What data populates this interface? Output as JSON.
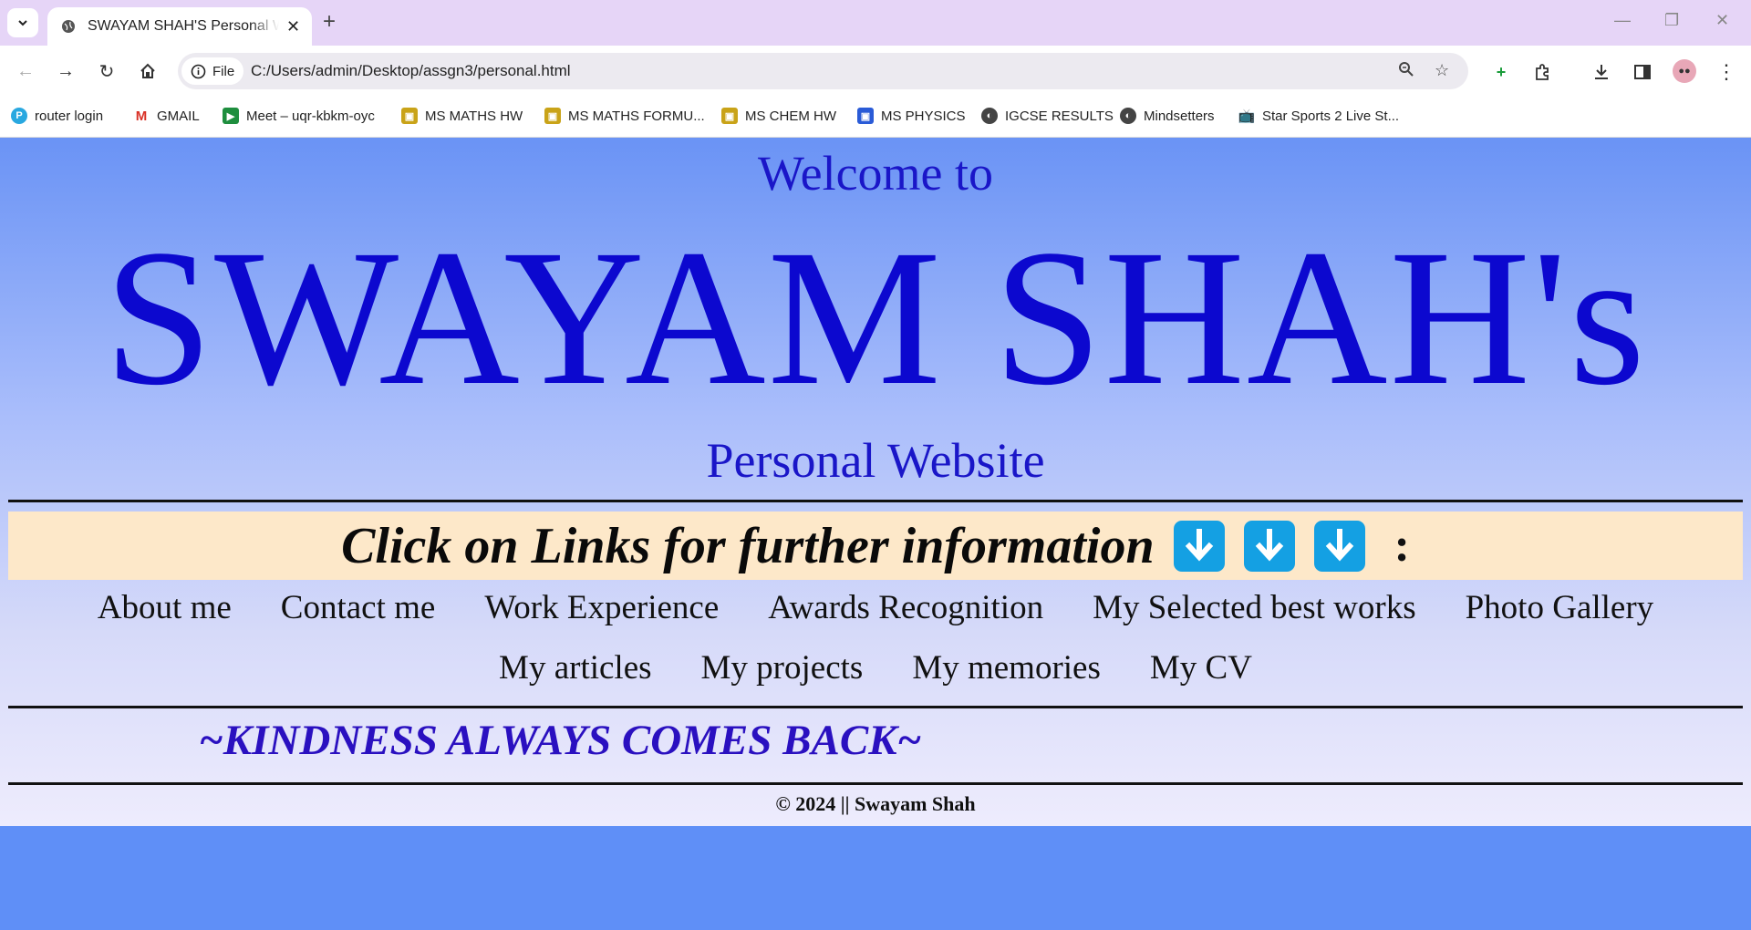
{
  "browser": {
    "tab_title": "SWAYAM SHAH'S Personal Website",
    "site_chip_label": "File",
    "url": "C:/Users/admin/Desktop/assgn3/personal.html",
    "bookmarks": [
      {
        "label": "router login"
      },
      {
        "label": "GMAIL"
      },
      {
        "label": "Meet – uqr-kbkm-oyc"
      },
      {
        "label": "MS MATHS HW"
      },
      {
        "label": "MS MATHS FORMU..."
      },
      {
        "label": "MS CHEM HW"
      },
      {
        "label": "MS PHYSICS"
      },
      {
        "label": "IGCSE RESULTS"
      },
      {
        "label": "Mindsetters"
      },
      {
        "label": "Star Sports 2 Live St..."
      }
    ]
  },
  "page": {
    "welcome": "Welcome to",
    "title": "SWAYAM SHAH's",
    "subtitle": "Personal Website",
    "click_prompt": "Click on Links for further information",
    "colon": ":",
    "nav_row1": [
      "About me",
      "Contact me",
      "Work Experience",
      "Awards Recognition",
      "My Selected best works",
      "Photo Gallery"
    ],
    "nav_row2": [
      "My articles",
      "My projects",
      "My memories",
      "My CV"
    ],
    "motto": "~KINDNESS ALWAYS COMES BACK~",
    "footer": "© 2024 || Swayam Shah"
  },
  "colors": {
    "title_blue": "#0c08cf",
    "banner_bg": "#fde8c9",
    "arrow_bg": "#14a0e3",
    "motto": "#2a10c0"
  }
}
